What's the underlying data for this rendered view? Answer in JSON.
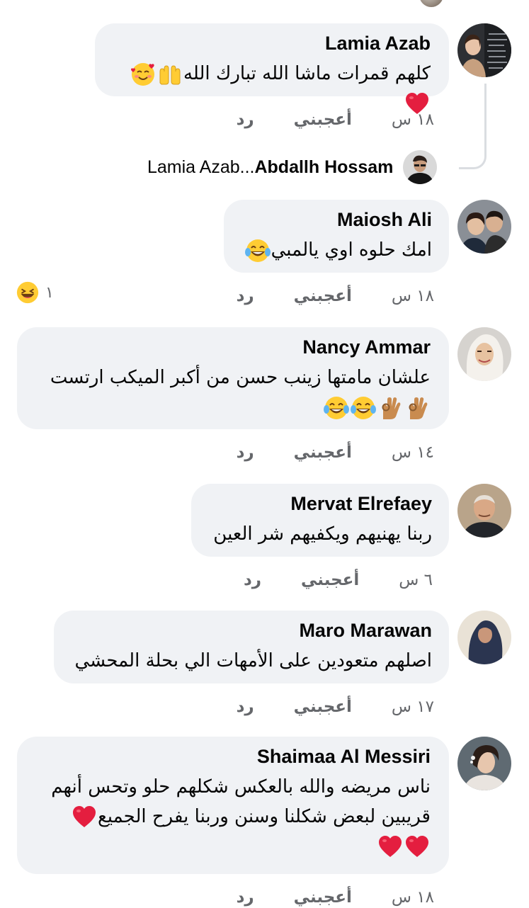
{
  "comments": [
    {
      "name": "Lamia Azab",
      "text": "كلهم قمرات ماشا الله تبارك الله",
      "emojis": [
        "open-hands",
        "smiling-hearts-face",
        "red-heart"
      ],
      "time": "١٨ س",
      "like": "أعجبني",
      "reply": "رد"
    },
    {
      "name": "Maiosh Ali",
      "text": "امك حلوه اوي يالمبي",
      "emojis": [
        "tears-of-joy-face"
      ],
      "time": "١٨ س",
      "like": "أعجبني",
      "reply": "رد",
      "reaction_count": "١",
      "reaction_icon": "haha-reaction"
    },
    {
      "name": "Nancy Ammar",
      "text_line1": "علشان مامتها زينب حسن من أكبر الميكب ارتست",
      "emojis": [
        "ok-hand",
        "ok-hand",
        "tears-of-joy-face",
        "tears-of-joy-face"
      ],
      "time": "١٤ س",
      "like": "أعجبني",
      "reply": "رد"
    },
    {
      "name": "Mervat Elrefaey",
      "text": "ربنا يهنيهم ويكفيهم شر العين",
      "time": "٦ س",
      "like": "أعجبني",
      "reply": "رد"
    },
    {
      "name": "Maro Marawan",
      "text": "اصلهم متعودين على الأمهات الي بحلة المحشي",
      "time": "١٧ س",
      "like": "أعجبني",
      "reply": "رد"
    },
    {
      "name": "Shaimaa Al Messiri",
      "text_line1": "ناس مريضه والله بالعكس شكلهم حلو وتحس أنهم",
      "text_line2": "قريبين لبعض شكلنا وسنن وربنا يفرح الجميع",
      "emojis": [
        "red-heart",
        "red-heart",
        "red-heart"
      ],
      "time": "١٨ س",
      "like": "أعجبني",
      "reply": "رد"
    }
  ],
  "reply_preview": {
    "author": "Abdallh Hossam",
    "separator": " ... ",
    "mention": "Lamia Azab"
  },
  "colors": {
    "bubble_bg": "#f0f2f5",
    "meta_text": "#65676b",
    "heart": "#e41e3f",
    "emoji_yellow": "#ffcc33",
    "thread_line": "#dadde1"
  }
}
